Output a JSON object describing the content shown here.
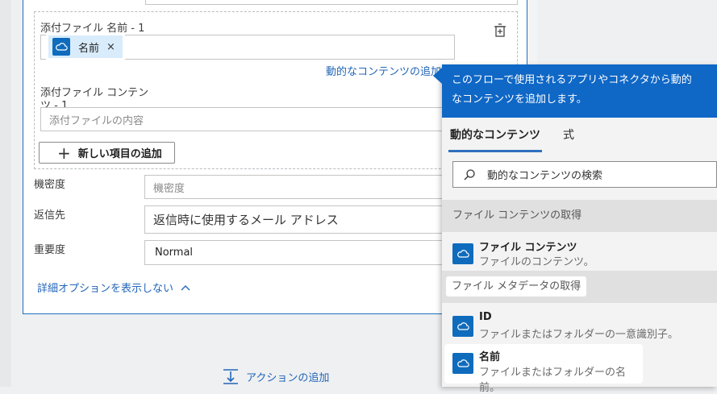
{
  "form": {
    "attach_name_label": "添付ファイル 名前 - 1",
    "token_name": "名前",
    "token_remove": "×",
    "add_dynamic_link": "動的なコンテンツの追加",
    "attach_content_label_line1": "添付ファイル コンテン",
    "attach_content_label_line2": "ツ - 1",
    "attach_content_placeholder": "添付ファイルの内容",
    "add_item_button": "新しい項目の追加",
    "sensitivity_label": "機密度",
    "sensitivity_placeholder": "機密度",
    "reply_to_label": "返信先",
    "reply_to_placeholder": "返信時に使用するメール アドレス",
    "importance_label": "重要度",
    "importance_value": "Normal",
    "hide_advanced_link": "詳細オプションを表示しない",
    "add_action": "アクションの追加"
  },
  "panel": {
    "header_text_line1": "このフローで使用されるアプリやコネクタから動的",
    "header_text_line2": "なコンテンツを追加します。",
    "tab_dynamic": "動的なコンテンツ",
    "tab_expression": "式",
    "search_placeholder": "動的なコンテンツの検索",
    "sections": [
      {
        "title": "ファイル コンテンツの取得",
        "items": [
          {
            "title": "ファイル コンテンツ",
            "desc": "ファイルのコンテンツ。"
          }
        ]
      },
      {
        "title": "ファイル メタデータの取得",
        "items": [
          {
            "title": "ID",
            "desc": "ファイルまたはフォルダーの一意識別子。"
          },
          {
            "title": "名前",
            "desc": "ファイルまたはフォルダーの名前。"
          }
        ]
      }
    ]
  },
  "icons": {
    "onedrive": "onedrive-cloud-icon",
    "delete": "delete-icon",
    "plus": "plus-icon",
    "search": "search-icon",
    "chevron": "chevron-up-icon",
    "add_action": "insert-step-icon"
  },
  "colors": {
    "accent": "#0f67c6",
    "link": "#2366b8",
    "tile": "#0f6cbd",
    "token_bg": "#d9ecfb"
  }
}
